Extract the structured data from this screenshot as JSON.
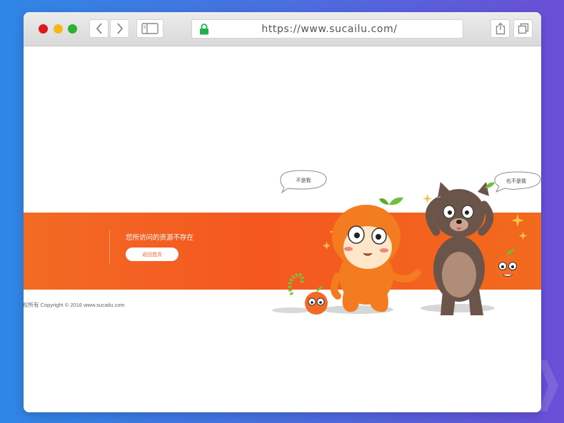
{
  "browser": {
    "url": "https://www.sucailu.com/"
  },
  "page": {
    "error_message": "您所访问的资源不存在",
    "home_button_label": "返回首页",
    "footer_text": "权所有 Copyright © 2016 www.sucailu.com",
    "speech_bubble_left": "不是我",
    "speech_bubble_right": "也不是我",
    "accent_color": "#f26b24"
  },
  "icons": [
    "back-icon",
    "forward-icon",
    "sidebar-icon",
    "lock-icon",
    "share-icon",
    "tabs-icon"
  ]
}
